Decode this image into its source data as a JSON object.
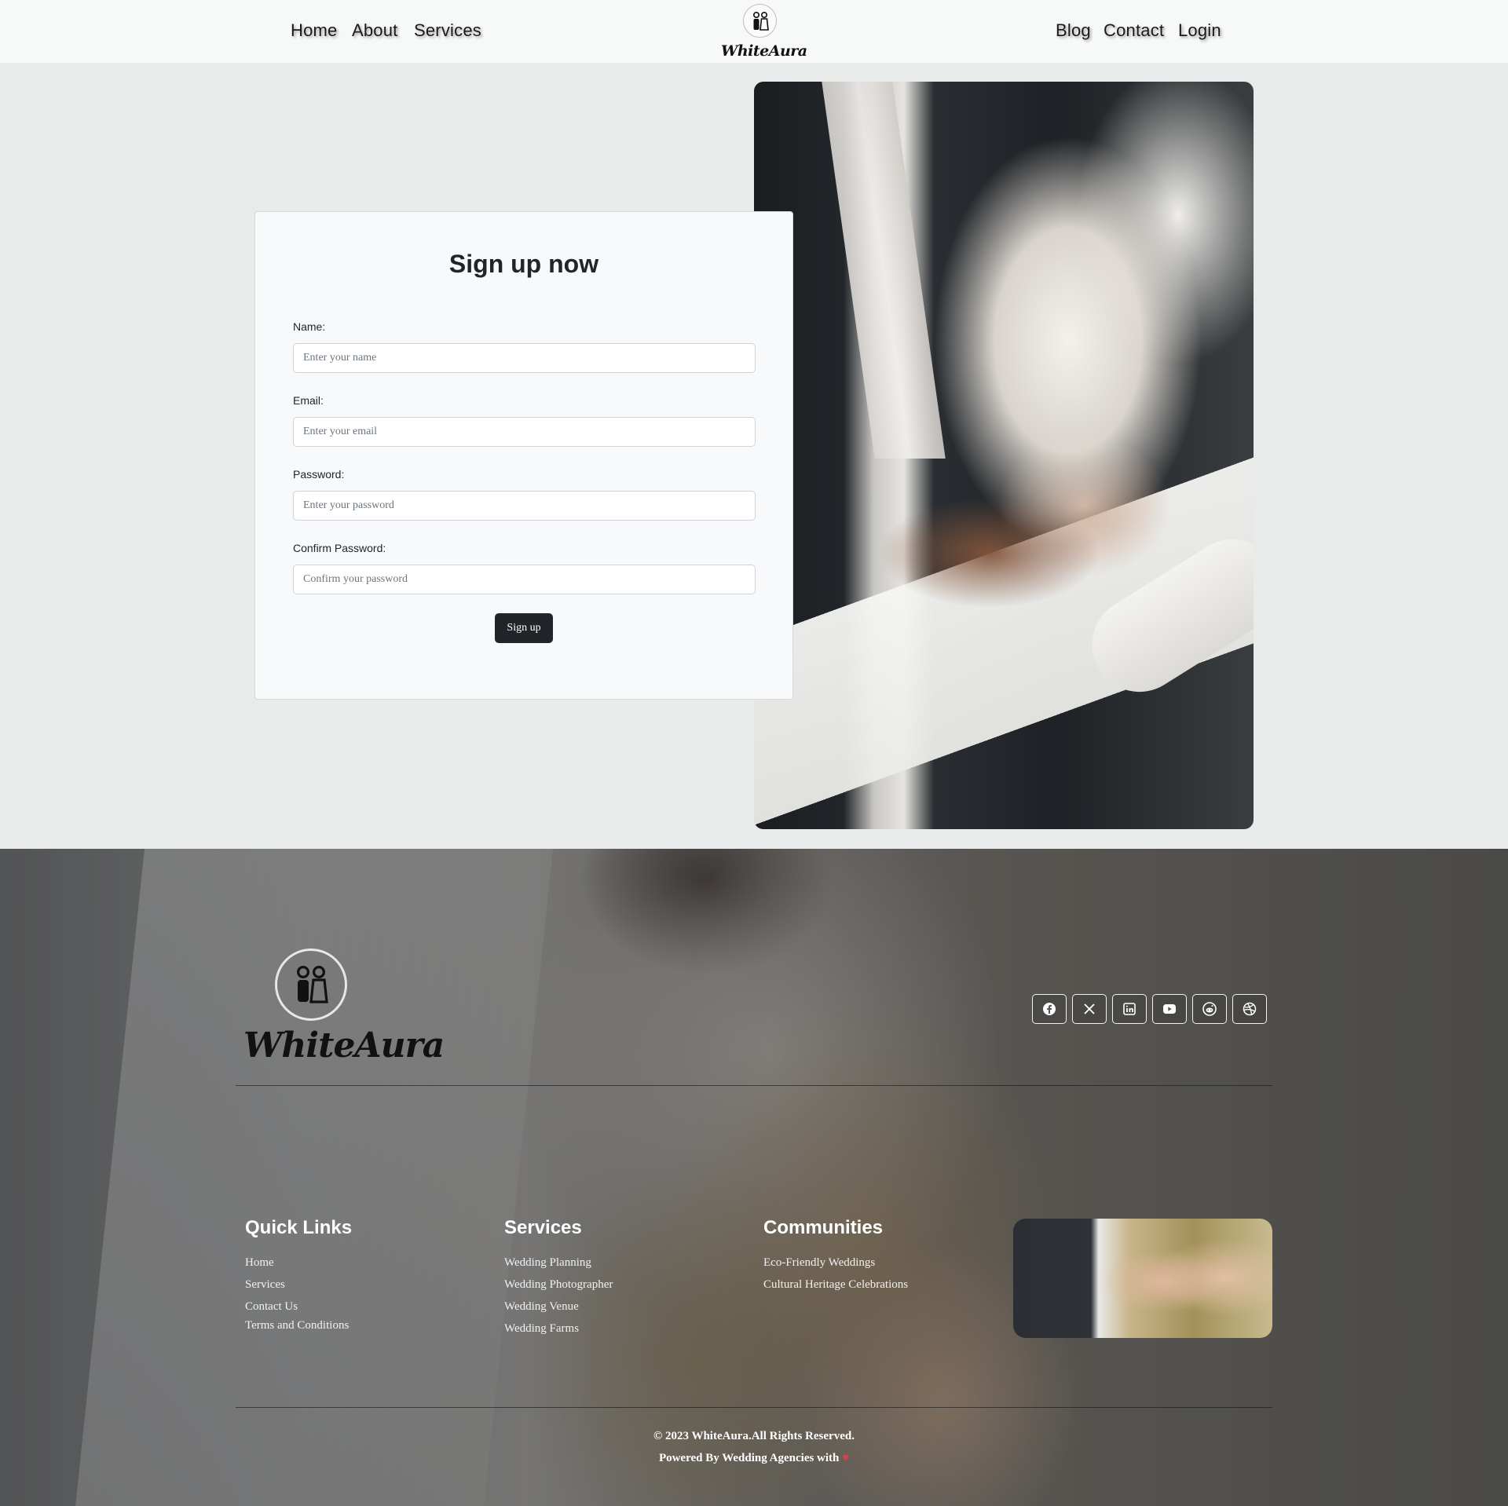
{
  "nav": {
    "left": [
      "Home",
      "About",
      "Services"
    ],
    "right": [
      "Blog",
      "Contact",
      "Login"
    ],
    "brand": "WhiteAura"
  },
  "signup": {
    "title": "Sign up now",
    "fields": [
      {
        "label": "Name:",
        "placeholder": "Enter your name"
      },
      {
        "label": "Email:",
        "placeholder": "Enter your email"
      },
      {
        "label": "Password:",
        "placeholder": "Enter your password"
      },
      {
        "label": "Confirm Password:",
        "placeholder": "Confirm your password"
      }
    ],
    "button": "Sign up"
  },
  "footer": {
    "brand": "WhiteAura",
    "social": [
      "facebook-icon",
      "x-twitter-icon",
      "linkedin-icon",
      "youtube-icon",
      "reddit-icon",
      "dribbble-icon"
    ],
    "quick_links": {
      "heading": "Quick Links",
      "items": [
        "Home",
        "Services",
        "Contact Us",
        "Terms and Conditions"
      ]
    },
    "services": {
      "heading": "Services",
      "items": [
        "Wedding Planning",
        "Wedding Photographer",
        "Wedding Venue",
        "Wedding Farms"
      ]
    },
    "communities": {
      "heading": "Communities",
      "items": [
        "Eco-Friendly Weddings",
        "Cultural Heritage Celebrations"
      ]
    },
    "copyright": "© 2023 WhiteAura.All Rights Reserved.",
    "powered_by": "Powered By Wedding Agencies with",
    "heart": "♥"
  },
  "colors": {
    "primary_button": "#212529",
    "page_background": "#e9eaea",
    "navbar_background": "#f7f9f8",
    "heart": "#e63946"
  }
}
